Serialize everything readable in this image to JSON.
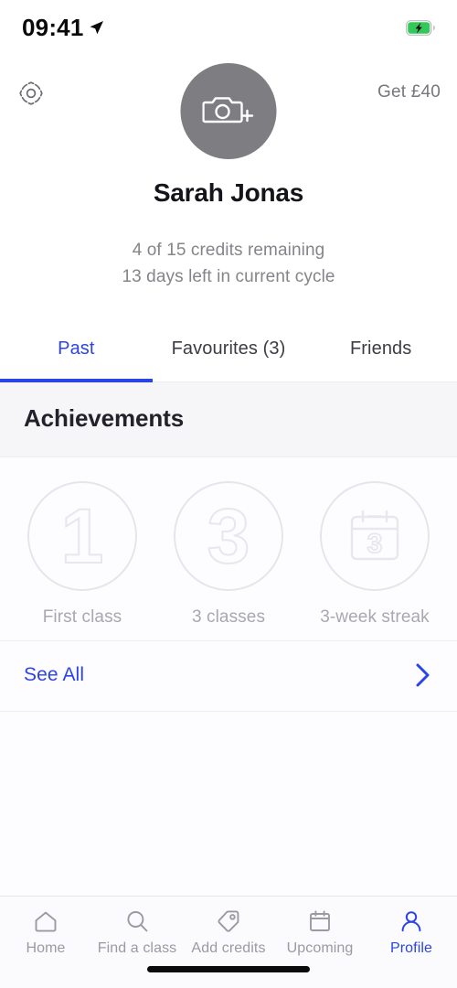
{
  "status_bar": {
    "time": "09:41",
    "location_icon": "location-arrow-icon",
    "battery_icon": "battery-charging-icon",
    "battery_color": "#34c759"
  },
  "header": {
    "settings_icon": "gear-icon",
    "avatar_icon": "camera-plus-icon",
    "avatar_color": "#7e7d82",
    "referral_label": "Get £40",
    "user_name": "Sarah Jonas",
    "credits_line1": "4 of 15 credits remaining",
    "credits_line2": "13 days left in current cycle"
  },
  "tabs": {
    "accent_color": "#2b44e8",
    "items": [
      {
        "label": "Past",
        "active": true
      },
      {
        "label": "Favourites (3)",
        "active": false
      },
      {
        "label": "Friends",
        "active": false
      }
    ]
  },
  "achievements": {
    "title": "Achievements",
    "badges": [
      {
        "glyph": "1",
        "icon": "number-one-badge-icon",
        "label": "First class"
      },
      {
        "glyph": "3",
        "icon": "number-three-badge-icon",
        "label": "3 classes"
      },
      {
        "glyph": "3",
        "icon": "calendar-three-badge-icon",
        "label": "3-week streak"
      }
    ],
    "see_all_label": "See All",
    "see_all_icon": "chevron-right-icon"
  },
  "bottom_nav": {
    "active_color": "#2b44e8",
    "inactive_color": "#9b9aa2",
    "items": [
      {
        "label": "Home",
        "icon": "home-icon",
        "active": false
      },
      {
        "label": "Find a class",
        "icon": "search-icon",
        "active": false
      },
      {
        "label": "Add credits",
        "icon": "tag-icon",
        "active": false
      },
      {
        "label": "Upcoming",
        "icon": "calendar-icon",
        "active": false
      },
      {
        "label": "Profile",
        "icon": "person-icon",
        "active": true
      }
    ]
  }
}
